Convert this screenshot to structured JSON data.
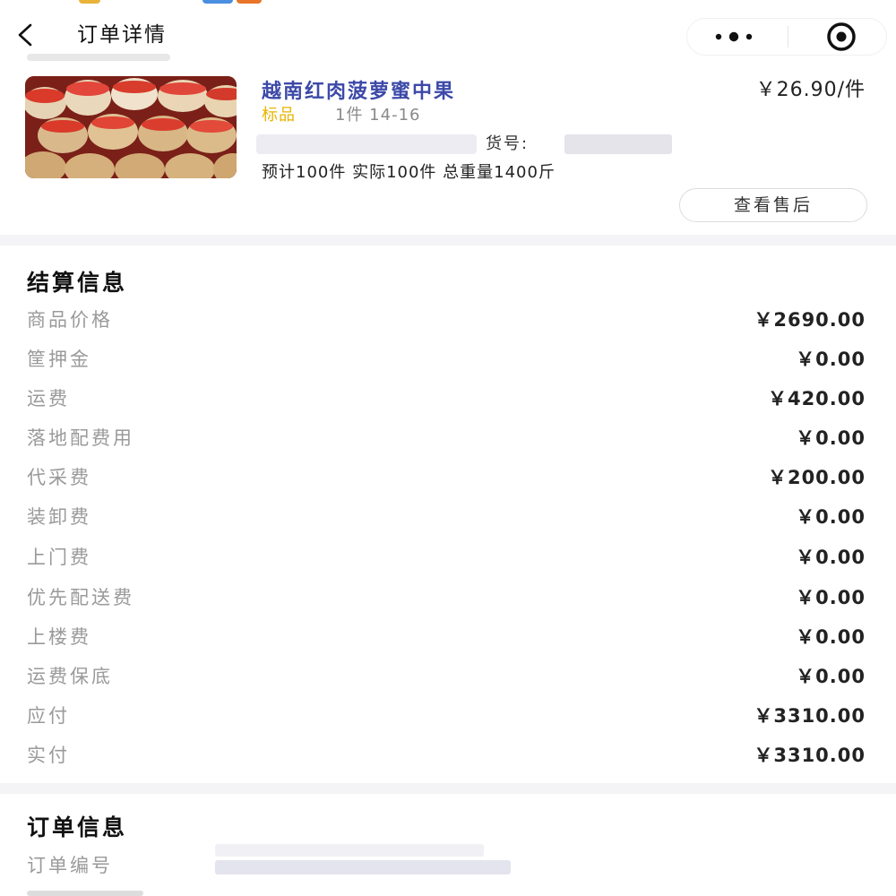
{
  "nav": {
    "title": "订单详情"
  },
  "product": {
    "name": "越南红肉菠萝蜜中果",
    "price": "￥26.90/件",
    "tag": "标品",
    "spec": "1件 14-16",
    "sku_label": "货号:",
    "qty_line": "预计100件  实际100件  总重量1400斤",
    "after_sale_label": "查看售后"
  },
  "settlement": {
    "title": "结算信息",
    "rows": [
      {
        "label": "商品价格",
        "value": "￥2690.00"
      },
      {
        "label": "筐押金",
        "value": "￥0.00"
      },
      {
        "label": "运费",
        "value": "￥420.00"
      },
      {
        "label": "落地配费用",
        "value": "￥0.00"
      },
      {
        "label": "代采费",
        "value": "￥200.00"
      },
      {
        "label": "装卸费",
        "value": "￥0.00"
      },
      {
        "label": "上门费",
        "value": "￥0.00"
      },
      {
        "label": "优先配送费",
        "value": "￥0.00"
      },
      {
        "label": "上楼费",
        "value": "￥0.00"
      },
      {
        "label": "运费保底",
        "value": "￥0.00"
      },
      {
        "label": "应付",
        "value": "￥3310.00"
      },
      {
        "label": "实付",
        "value": "￥3310.00"
      }
    ]
  },
  "order": {
    "title": "订单信息",
    "number_label": "订单编号"
  },
  "colors": {
    "accent_blue": "#3c49a8",
    "tag_yellow": "#e8b400",
    "muted_gray": "#9a9a9a"
  },
  "icons": [
    "back-icon",
    "more-icon",
    "target-icon"
  ]
}
